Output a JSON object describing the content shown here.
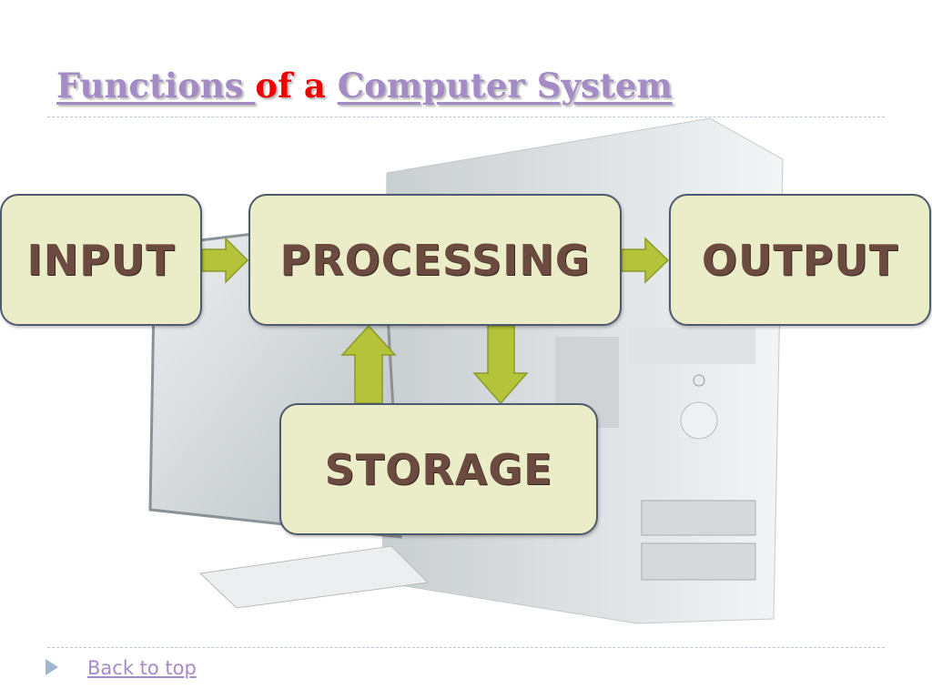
{
  "title": {
    "part1": "Functions ",
    "part2": "of a",
    "part3": "Computer System"
  },
  "diagram": {
    "nodes": {
      "input": "INPUT",
      "processing": "PROCESSING",
      "output": "OUTPUT",
      "storage": "STORAGE"
    },
    "colors": {
      "box_fill": "#ebecc8",
      "box_border": "#4f5a6e",
      "arrow": "#b5c33a",
      "text": "#6b4a40"
    }
  },
  "footer": {
    "link": "Back to top"
  }
}
